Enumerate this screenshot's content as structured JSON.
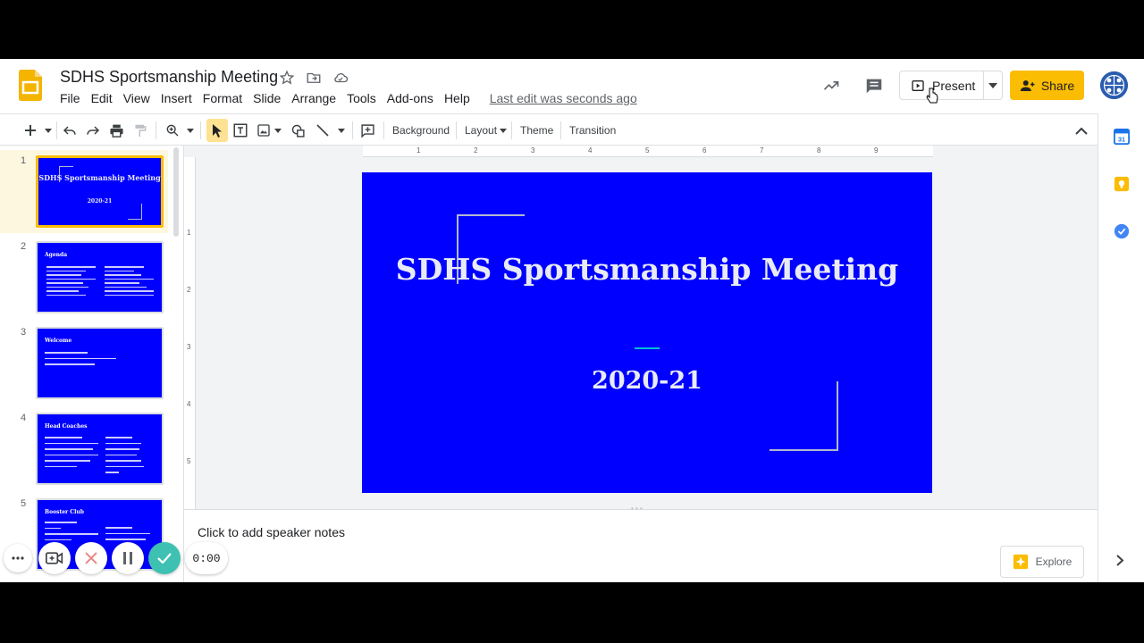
{
  "document": {
    "title": "SDHS Sportsmanship Meeting",
    "last_edit": "Last edit was seconds ago"
  },
  "menu": [
    "File",
    "Edit",
    "View",
    "Insert",
    "Format",
    "Slide",
    "Arrange",
    "Tools",
    "Add-ons",
    "Help"
  ],
  "header": {
    "present_label": "Present",
    "share_label": "Share"
  },
  "toolbar": {
    "background_label": "Background",
    "layout_label": "Layout",
    "theme_label": "Theme",
    "transition_label": "Transition"
  },
  "slides": [
    {
      "number": "1",
      "title": "SDHS Sportsmanship Meeting",
      "subtitle": "2020-21"
    },
    {
      "number": "2",
      "title": "Agenda"
    },
    {
      "number": "3",
      "title": "Welcome"
    },
    {
      "number": "4",
      "title": "Head Coaches"
    },
    {
      "number": "5",
      "title": "Booster Club"
    }
  ],
  "current_slide": {
    "title": "SDHS Sportsmanship Meeting",
    "subtitle": "2020-21"
  },
  "ruler": {
    "top": [
      "1",
      "2",
      "3",
      "4",
      "5",
      "6",
      "7",
      "8",
      "9"
    ],
    "left": [
      "1",
      "2",
      "3",
      "4",
      "5"
    ]
  },
  "notes": {
    "placeholder": "Click to add speaker notes",
    "explore_label": "Explore"
  },
  "recorder": {
    "timer": "0:00"
  },
  "colors": {
    "slide_bg": "#0000ff",
    "accent": "#00bcd4",
    "share": "#fbbc04"
  }
}
